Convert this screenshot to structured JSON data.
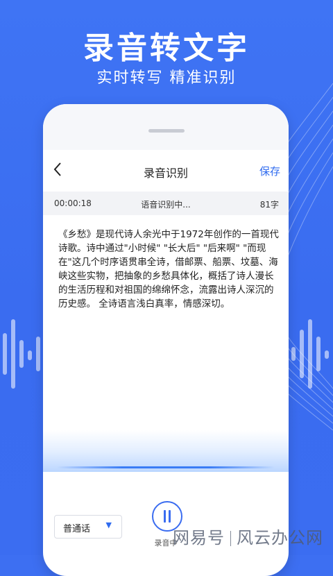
{
  "banner": {
    "headline": "录音转文字",
    "subline": "实时转写 精准识别"
  },
  "navbar": {
    "back_icon": "chevron-left-icon",
    "title": "录音识别",
    "save_label": "保存"
  },
  "status": {
    "elapsed": "00:00:18",
    "state": "语音识别中...",
    "char_count": "81字"
  },
  "transcript": {
    "text": "《乡愁》是现代诗人余光中于1972年创作的一首现代诗歌。诗中通过\"小时候\" \"长大后\" \"后来啊\" \"而现在\"这几个时序语贯串全诗，借邮票、船票、坟墓、海峡这些实物，把抽象的乡愁具体化，概括了诗人漫长的生活历程和对祖国的绵绵怀念，流露出诗人深沉的历史感。 全诗语言浅白真率，情感深切。"
  },
  "controls": {
    "language_value": "普通话",
    "dropdown_icon": "triangle-down-icon",
    "pause_icon": "pause-icon",
    "recording_label": "录音中"
  },
  "watermark": {
    "left": "网易号",
    "right": "风云办公网"
  },
  "colors": {
    "brand_blue": "#3a6cf0",
    "link_blue": "#2f6bef"
  }
}
